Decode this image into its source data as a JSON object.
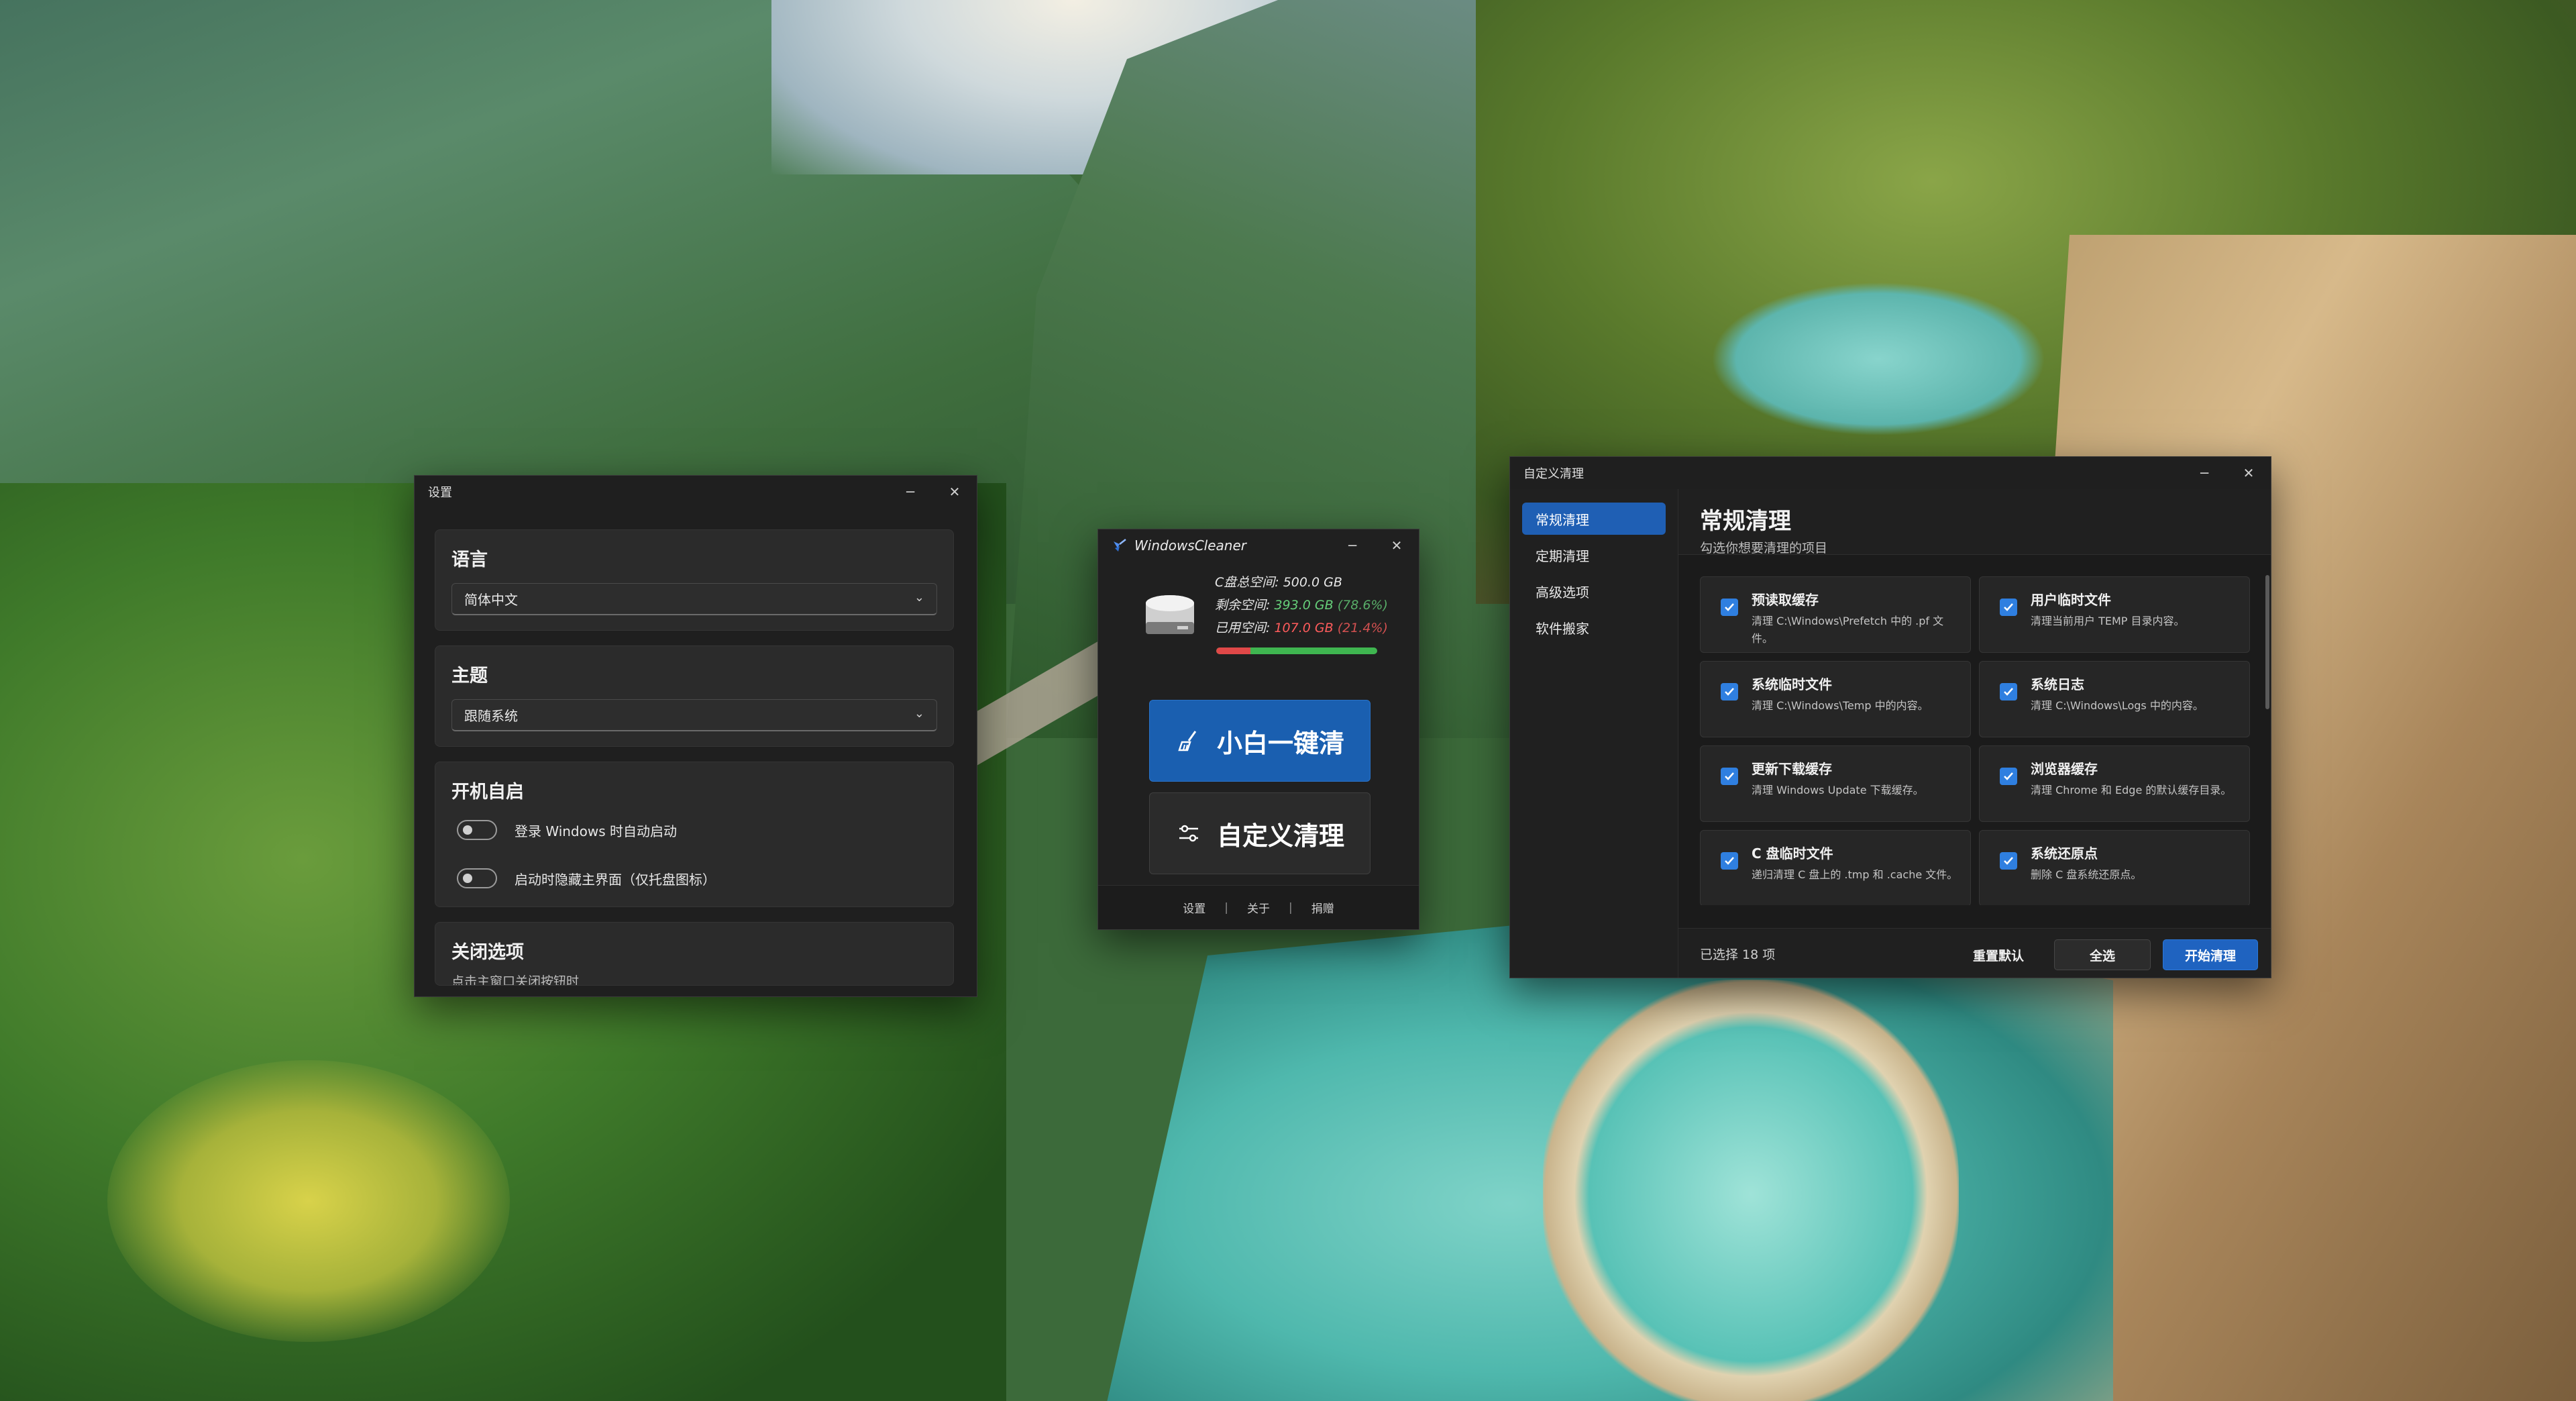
{
  "settings": {
    "title": "设置",
    "language": {
      "title": "语言",
      "value": "简体中文"
    },
    "theme": {
      "title": "主题",
      "value": "跟随系统"
    },
    "startup": {
      "title": "开机自启",
      "toggle1": "登录 Windows 时自动启动",
      "toggle2": "启动时隐藏主界面（仅托盘图标）"
    },
    "close": {
      "title": "关闭选项",
      "sub": "点击主窗口关闭按钮时"
    }
  },
  "main": {
    "title": "WindowsCleaner",
    "disk": {
      "total_label": "C盘总空间: ",
      "total_value": "500.0 GB",
      "free_label": "剩余空间: ",
      "free_value": "393.0 GB",
      "free_pct": "(78.6%)",
      "used_label": "已用空间: ",
      "used_value": "107.0 GB",
      "used_pct": "(21.4%)",
      "used_fraction": 0.214
    },
    "btn_quick": "小白一键清",
    "btn_custom": "自定义清理",
    "footer": {
      "settings": "设置",
      "sep": "|",
      "about": "关于",
      "donate": "捐赠"
    }
  },
  "custom": {
    "title": "自定义清理",
    "nav": [
      "常规清理",
      "定期清理",
      "高级选项",
      "软件搬家"
    ],
    "heading": "常规清理",
    "subheading": "勾选你想要清理的项目",
    "items": [
      {
        "title": "预读取缓存",
        "desc": "清理 C:\\Windows\\Prefetch 中的 .pf 文件。"
      },
      {
        "title": "用户临时文件",
        "desc": "清理当前用户 TEMP 目录内容。"
      },
      {
        "title": "系统临时文件",
        "desc": "清理 C:\\Windows\\Temp 中的内容。"
      },
      {
        "title": "系统日志",
        "desc": "清理 C:\\Windows\\Logs 中的内容。"
      },
      {
        "title": "更新下载缓存",
        "desc": "清理 Windows Update 下载缓存。"
      },
      {
        "title": "浏览器缓存",
        "desc": "清理 Chrome 和 Edge 的默认缓存目录。"
      },
      {
        "title": "C 盘临时文件",
        "desc": "递归清理 C 盘上的 .tmp 和 .cache 文件。"
      },
      {
        "title": "系统还原点",
        "desc": "删除 C 盘系统还原点。"
      }
    ],
    "selected": "已选择 18 项",
    "btn_reset": "重置默认",
    "btn_all": "全选",
    "btn_start": "开始清理"
  },
  "colors": {
    "accent": "#1f63c0",
    "free": "#66d07a",
    "used": "#ff5c5c"
  }
}
